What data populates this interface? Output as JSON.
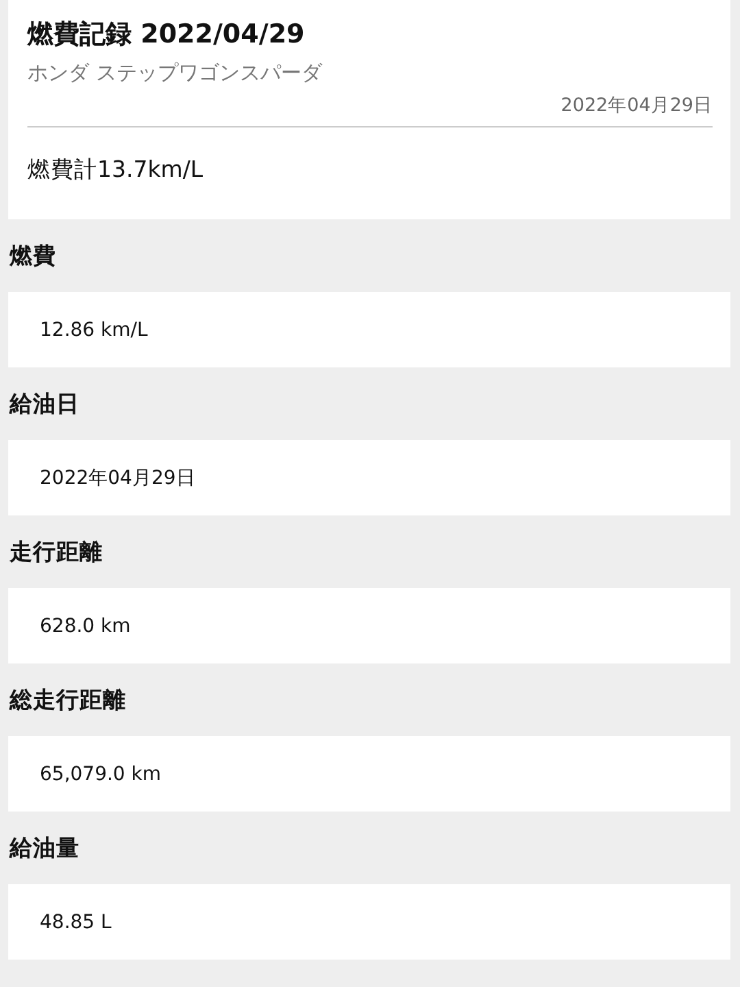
{
  "header": {
    "title": "燃費記録 2022/04/29",
    "vehicle": "ホンダ ステップワゴンスパーダ",
    "date": "2022年04月29日",
    "meter": "燃費計13.7km/L"
  },
  "fields": [
    {
      "label": "燃費",
      "value": "12.86 km/L"
    },
    {
      "label": "給油日",
      "value": "2022年04月29日"
    },
    {
      "label": "走行距離",
      "value": "628.0 km"
    },
    {
      "label": "総走行距離",
      "value": "65,079.0 km"
    },
    {
      "label": "給油量",
      "value": "48.85 L"
    }
  ]
}
